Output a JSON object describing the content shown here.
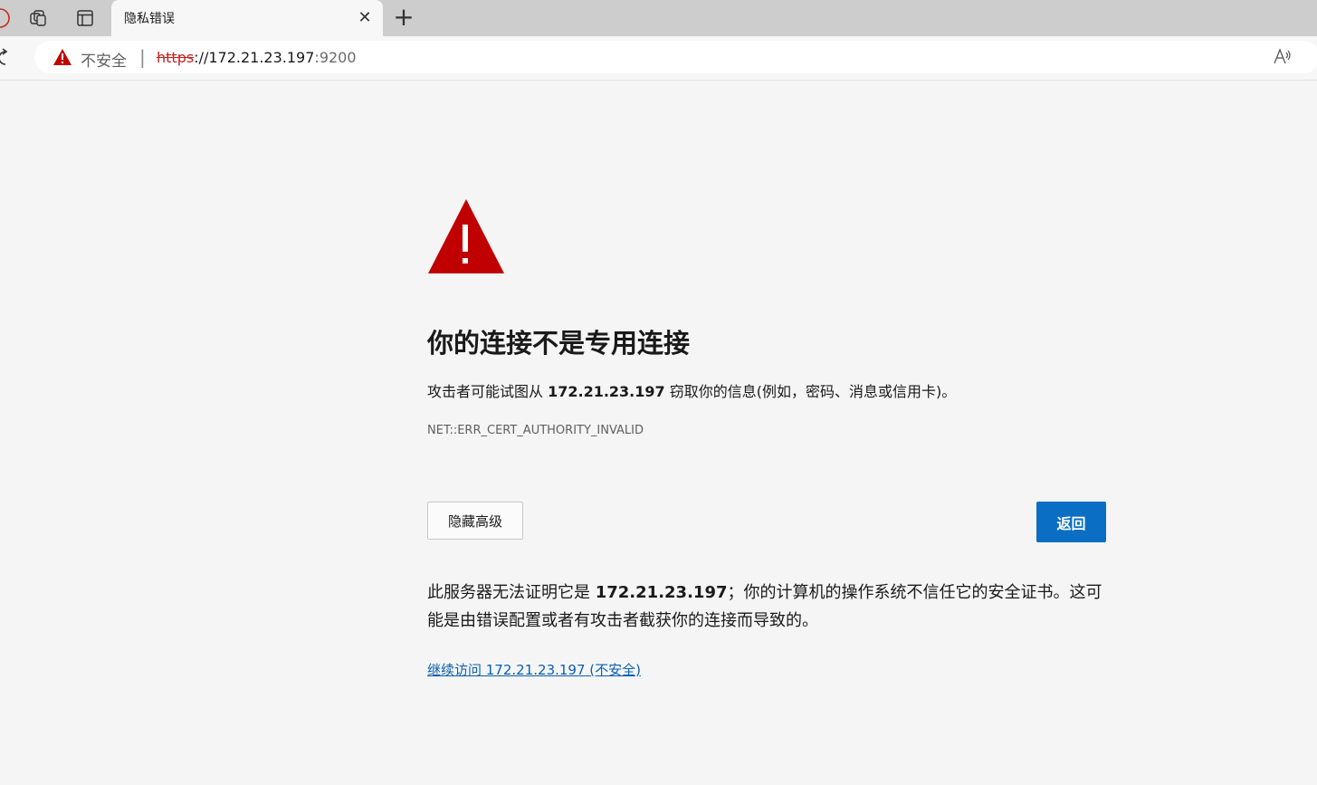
{
  "browser": {
    "tab": {
      "title": "隐私错误",
      "close_symbol": "✕"
    },
    "new_tab_symbol": "+",
    "address_bar": {
      "security_label": "不安全",
      "separator": "|",
      "url_scheme": "https",
      "url_sep": "://",
      "url_host": "172.21.23.197",
      "url_port": ":9200",
      "read_aloud_symbol": "À"
    }
  },
  "page": {
    "heading": "你的连接不是专用连接",
    "desc_before": "攻击者可能试图从 ",
    "desc_host": "172.21.23.197",
    "desc_after": " 窃取你的信息(例如，密码、消息或信用卡)。",
    "error_code": "NET::ERR_CERT_AUTHORITY_INVALID",
    "hide_advanced_label": "隐藏高级",
    "back_label": "返回",
    "detail_before": "此服务器无法证明它是 ",
    "detail_host": "172.21.23.197",
    "detail_after": "；你的计算机的操作系统不信任它的安全证书。这可能是由错误配置或者有攻击者截获你的连接而导致的。",
    "proceed_link": "继续访问 172.21.23.197 (不安全)"
  },
  "colors": {
    "warning_red": "#c00000",
    "button_blue": "#0a6fc4",
    "link_blue": "#0a5fb0"
  }
}
